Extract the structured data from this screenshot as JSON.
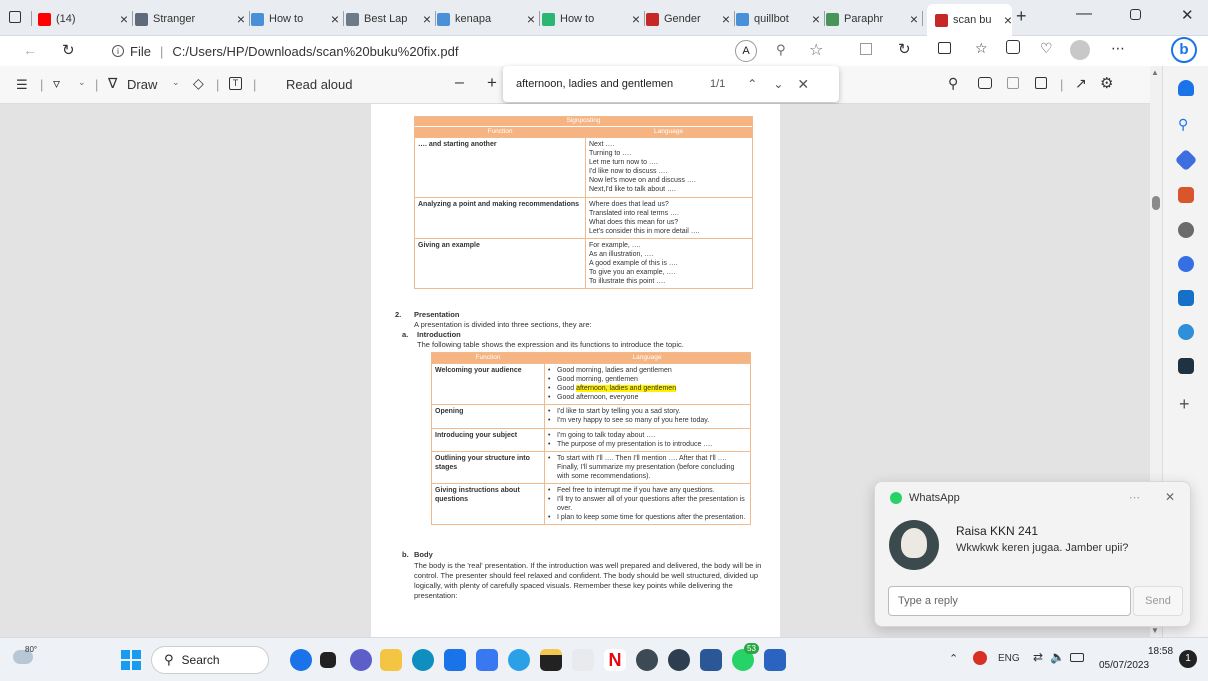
{
  "tabs": [
    {
      "label": "(14)",
      "icon": "youtube-icon",
      "color": "#ff0000"
    },
    {
      "label": "Stranger",
      "icon": "page-icon",
      "color": "#5f6b7a"
    },
    {
      "label": "How to",
      "icon": "search-icon",
      "color": "#4a90d9"
    },
    {
      "label": "Best Lap",
      "icon": "chart-icon",
      "color": "#6c7a89"
    },
    {
      "label": "kenapa",
      "icon": "search-icon",
      "color": "#4a90d9"
    },
    {
      "label": "How to",
      "icon": "globe-icon",
      "color": "#2bb673"
    },
    {
      "label": "Gender",
      "icon": "pdf-icon",
      "color": "#c62828"
    },
    {
      "label": "quillbot",
      "icon": "search-icon",
      "color": "#4a90d9"
    },
    {
      "label": "Paraphr",
      "icon": "quillbot-icon",
      "color": "#499557"
    },
    {
      "label": "scan bu",
      "icon": "pdf-icon",
      "color": "#c62828"
    }
  ],
  "address": {
    "prefix": "File",
    "url": "C:/Users/HP/Downloads/scan%20buku%20fix.pdf"
  },
  "pdf_toolbar": {
    "draw": "Draw",
    "read_aloud": "Read aloud"
  },
  "find": {
    "query": "afternoon, ladies and gentlemen",
    "count": "1/1"
  },
  "signposting": {
    "title": "Signposting",
    "col1": "Function",
    "col2": "Language",
    "rows": [
      {
        "f": "…. and starting another",
        "l": [
          "Next ….",
          "Turning to ….",
          "Let me turn now to ….",
          "I'd like now to discuss ….",
          "Now let's move on and discuss ….",
          "Next,I'd like to talk about …."
        ]
      },
      {
        "f": "Analyzing a point and making recommendations",
        "l": [
          "Where does that lead us?",
          "Translated into real terms ….",
          "What does this mean for us?",
          "Let's consider this in more detail …."
        ]
      },
      {
        "f": "Giving an example",
        "l": [
          "For example, ….",
          "As an illustration, ….",
          "A good example of this is ….",
          "To give you an example, ….",
          "To illustrate this point …."
        ]
      }
    ]
  },
  "section2": {
    "num": "2.",
    "heading": "Presentation",
    "intro": "A presentation is divided into three sections, they are:",
    "a_label": "a.",
    "a_heading": "Introduction",
    "a_text": "The following table shows the expression and its functions to introduce the topic."
  },
  "intro_table": {
    "col1": "Function",
    "col2": "Language",
    "rows": [
      {
        "f": "Welcoming your audience",
        "l": [
          "Good morning, ladies and gentlemen",
          "Good morning, gentlemen",
          "Good afternoon, ladies and gentlemen",
          "Good afternoon, everyone"
        ]
      },
      {
        "f": "Opening",
        "l": [
          "I'd like to start by telling you a sad story.",
          "I'm very happy to see so many of you here today."
        ]
      },
      {
        "f": "Introducing your subject",
        "l": [
          "I'm going to talk today about ….",
          "The purpose of my presentation is to introduce …."
        ]
      },
      {
        "f": "Outlining your structure into stages",
        "l": [
          "To start with I'll …. Then I'll mention …. After that I'll …. Finally, I'll summarize my presentation (before concluding with some recommendations)."
        ]
      },
      {
        "f": "Giving instructions about questions",
        "l": [
          "Feel free to interrupt me if you have any questions.",
          "I'll try to answer all of your questions after the presentation is over.",
          "I plan to keep some time for questions after the presentation."
        ]
      }
    ],
    "highlight_prefix": "Good ",
    "highlight_text": "afternoon, ladies and gentlemen"
  },
  "body_section": {
    "label": "b.",
    "heading": "Body",
    "text": "The body is the 'real' presentation. If the introduction was well prepared and delivered, the body will be in control. The presenter should feel relaxed and confident. The body should be well structured, divided up logically, with plenty of carefully spaced visuals. Remember these key points while delivering the presentation:"
  },
  "whatsapp": {
    "app": "WhatsApp",
    "sender": "Raisa KKN 241",
    "message": "Wkwkwk keren jugaa. Jamber upii?",
    "reply_placeholder": "Type a reply",
    "send": "Send"
  },
  "taskbar": {
    "weather": "80°",
    "search": "Search",
    "lang": "ENG",
    "time": "18:58",
    "date": "05/07/2023",
    "badge": "53",
    "notif": "1"
  }
}
